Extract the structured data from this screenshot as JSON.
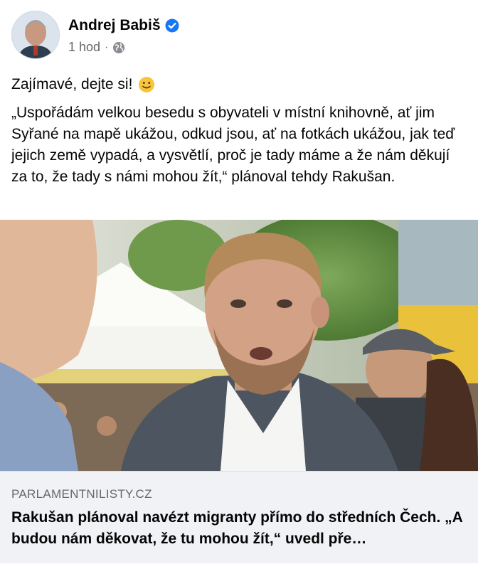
{
  "post": {
    "author": "Andrej Babiš",
    "time": "1 hod",
    "separator": "·",
    "audience_icon": "globe-icon",
    "verified_icon": "verified-badge-icon",
    "intro": "Zajímavé, dejte si!",
    "intro_emoji": "slightly-smiling-face-emoji",
    "quote": "„Uspořádám velkou besedu s obyvateli v místní knihovně, ať jim Syřané na mapě ukážou, odkud jsou, ať na fotkách ukážou, jak teď jejich země vypadá, a vysvětlí, proč je tady máme a že nám děkují za to, že tady s námi mohou žít,“ plánoval tehdy Rakušan."
  },
  "link_preview": {
    "domain": "PARLAMENTNILISTY.CZ",
    "title": "Rakušan plánoval navézt migranty přímo do středních Čech. „A budou nám děkovat, že tu mohou žít,“ uvedl pře…"
  },
  "colors": {
    "verified": "#1877f2",
    "meta": "#65676b",
    "link_bg": "#f0f2f5"
  }
}
